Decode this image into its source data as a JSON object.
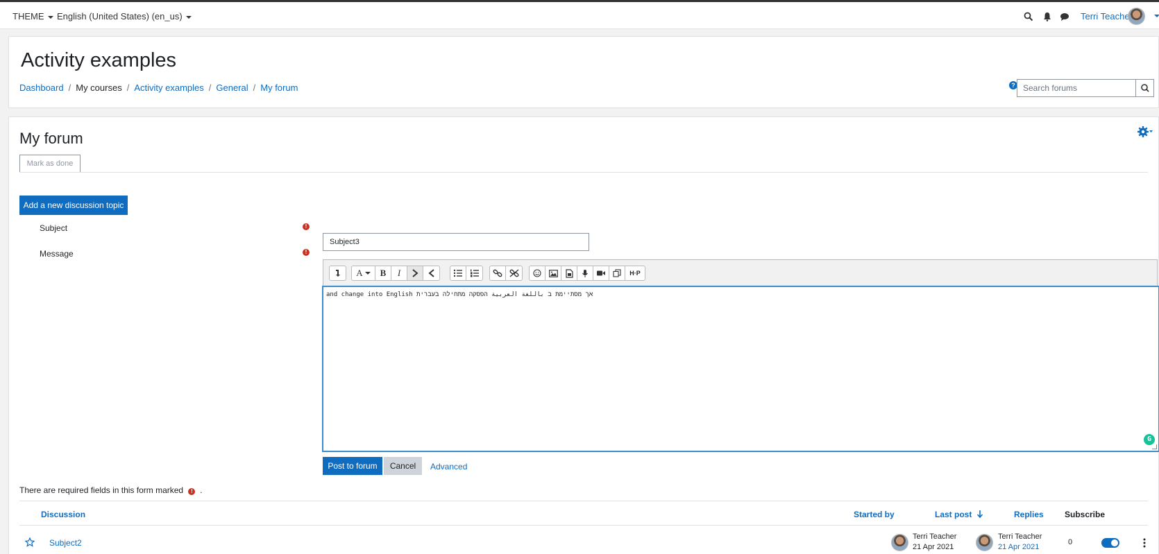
{
  "topbar": {
    "theme_menu": "THEME",
    "language_menu": "English (United States) (en_us)",
    "user_name": "Terri Teacher"
  },
  "header": {
    "title": "Activity examples",
    "breadcrumb": [
      "Dashboard",
      "My courses",
      "Activity examples",
      "General",
      "My forum"
    ],
    "search_placeholder": "Search forums"
  },
  "forum": {
    "title": "My forum",
    "mark_done_label": "Mark as done",
    "add_topic_label": "Add a new discussion topic",
    "subject_label": "Subject",
    "subject_value": "Subject3",
    "message_label": "Message",
    "message_text": "אך מסתיימת ב باللغة العربية הפסקה מתחילה בעברית and change into English",
    "post_label": "Post to forum",
    "cancel_label": "Cancel",
    "advanced_label": "Advanced",
    "required_note": "There are required fields in this form marked"
  },
  "table": {
    "headers": {
      "discussion": "Discussion",
      "started_by": "Started by",
      "last_post": "Last post",
      "replies": "Replies",
      "subscribe": "Subscribe"
    },
    "rows": [
      {
        "discussion": "Subject2",
        "started_by": "Terri Teacher",
        "started_date": "21 Apr 2021",
        "last_post_by": "Terri Teacher",
        "last_post_date": "21 Apr 2021",
        "replies": "0",
        "subscribed": true
      }
    ]
  },
  "colors": {
    "accent": "#0f6cbf",
    "required": "#ca3120",
    "editor_focus": "#3a8cd2"
  }
}
